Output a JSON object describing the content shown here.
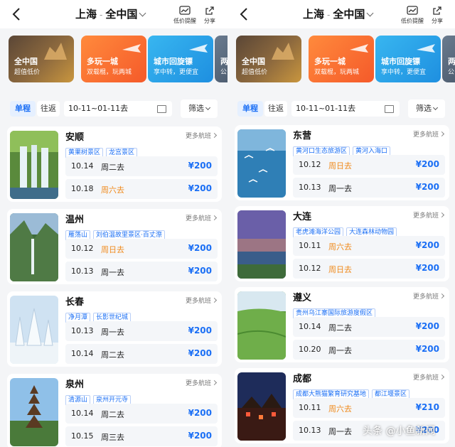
{
  "panels": [
    {
      "header": {
        "origin": "上海",
        "sep": "-",
        "destination": "全中国",
        "alert_label": "低价提醒",
        "share_label": "分享"
      },
      "categories": [
        {
          "title": "全中国",
          "subtitle": "超值低价"
        },
        {
          "title": "多玩一城",
          "subtitle": "双载棍，玩两城"
        },
        {
          "title": "城市回旋镖",
          "subtitle": "享中转，更便宜"
        },
        {
          "title": "两",
          "subtitle": "公"
        }
      ],
      "filter": {
        "oneway": "单程",
        "roundtrip": "往返",
        "date_range": "10-11~01-11去",
        "filter_label": "筛选"
      },
      "more_label": "更多航班",
      "cards": [
        {
          "city": "安顺",
          "tags": [
            "黄果树景区",
            "龙宫景区"
          ],
          "flights": [
            {
              "date": "10.14",
              "weekday": "周二去",
              "price": "¥200",
              "weekend": false
            },
            {
              "date": "10.18",
              "weekday": "周六去",
              "price": "¥200",
              "weekend": true
            }
          ]
        },
        {
          "city": "温州",
          "tags": [
            "雁荡山",
            "刘伯温故里景区·百丈漈"
          ],
          "flights": [
            {
              "date": "10.12",
              "weekday": "周日去",
              "price": "¥200",
              "weekend": true
            },
            {
              "date": "10.13",
              "weekday": "周一去",
              "price": "¥200",
              "weekend": false
            }
          ]
        },
        {
          "city": "长春",
          "tags": [
            "净月潭",
            "长影世纪城"
          ],
          "flights": [
            {
              "date": "10.13",
              "weekday": "周一去",
              "price": "¥200",
              "weekend": false
            },
            {
              "date": "10.14",
              "weekday": "周二去",
              "price": "¥200",
              "weekend": false
            }
          ]
        },
        {
          "city": "泉州",
          "tags": [
            "清源山",
            "泉州开元寺"
          ],
          "flights": [
            {
              "date": "10.14",
              "weekday": "周二去",
              "price": "¥200",
              "weekend": false
            },
            {
              "date": "10.15",
              "weekday": "周三去",
              "price": "¥200",
              "weekend": false
            }
          ]
        }
      ]
    },
    {
      "header": {
        "origin": "上海",
        "sep": "-",
        "destination": "全中国",
        "alert_label": "低价提醒",
        "share_label": "分享"
      },
      "categories": [
        {
          "title": "全中国",
          "subtitle": "超值低价"
        },
        {
          "title": "多玩一城",
          "subtitle": "双载棍，玩两城"
        },
        {
          "title": "城市回旋镖",
          "subtitle": "享中转，更便宜"
        },
        {
          "title": "两",
          "subtitle": "公"
        }
      ],
      "filter": {
        "oneway": "单程",
        "roundtrip": "往返",
        "date_range": "10-11~01-11去",
        "filter_label": "筛选"
      },
      "more_label": "更多航班",
      "cards": [
        {
          "city": "东营",
          "tags": [
            "黄河口生态旅游区",
            "黄河入海口"
          ],
          "flights": [
            {
              "date": "10.12",
              "weekday": "周日去",
              "price": "¥200",
              "weekend": true
            },
            {
              "date": "10.13",
              "weekday": "周一去",
              "price": "¥200",
              "weekend": false
            }
          ]
        },
        {
          "city": "大连",
          "tags": [
            "老虎滩海洋公园",
            "大连森林动物园"
          ],
          "flights": [
            {
              "date": "10.11",
              "weekday": "周六去",
              "price": "¥200",
              "weekend": true
            },
            {
              "date": "10.12",
              "weekday": "周日去",
              "price": "¥200",
              "weekend": true
            }
          ]
        },
        {
          "city": "遵义",
          "tags": [
            "贵州乌江寨国际旅游度假区"
          ],
          "flights": [
            {
              "date": "10.14",
              "weekday": "周二去",
              "price": "¥200",
              "weekend": false
            },
            {
              "date": "10.20",
              "weekday": "周一去",
              "price": "¥200",
              "weekend": false
            }
          ]
        },
        {
          "city": "成都",
          "tags": [
            "成都大熊猫繁育研究基地",
            "都江堰景区"
          ],
          "flights": [
            {
              "date": "10.11",
              "weekday": "周六去",
              "price": "¥210",
              "weekend": true
            },
            {
              "date": "10.13",
              "weekday": "周一去",
              "price": "¥200",
              "weekend": false
            }
          ]
        }
      ]
    }
  ],
  "watermark": "头条 @小鱼新闻",
  "colors": {
    "accent": "#1b6ff5",
    "weekend": "#f08a1c"
  }
}
